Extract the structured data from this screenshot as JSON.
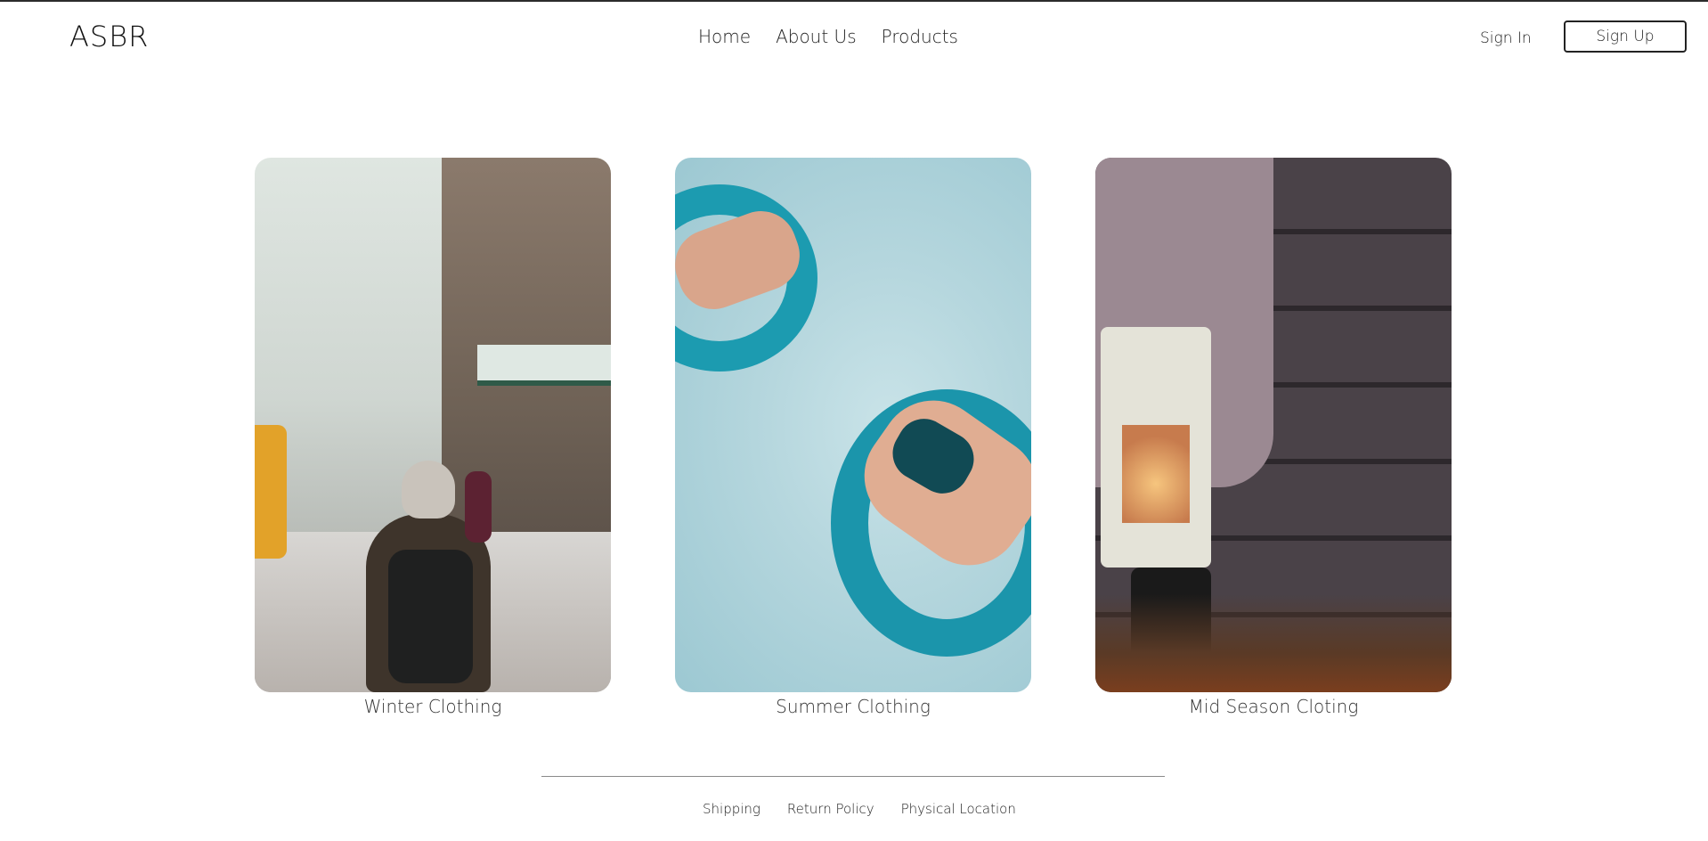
{
  "brand": {
    "logo": "ASBR"
  },
  "nav": {
    "home": "Home",
    "about": "About Us",
    "products": "Products"
  },
  "auth": {
    "sign_in": "Sign In",
    "sign_up": "Sign Up"
  },
  "categories": [
    {
      "label": "Winter Clothing"
    },
    {
      "label": "Summer Clothing"
    },
    {
      "label": "Mid Season Cloting"
    }
  ],
  "footer": {
    "shipping": "Shipping",
    "returns": "Return Policy",
    "location": "Physical Location"
  }
}
